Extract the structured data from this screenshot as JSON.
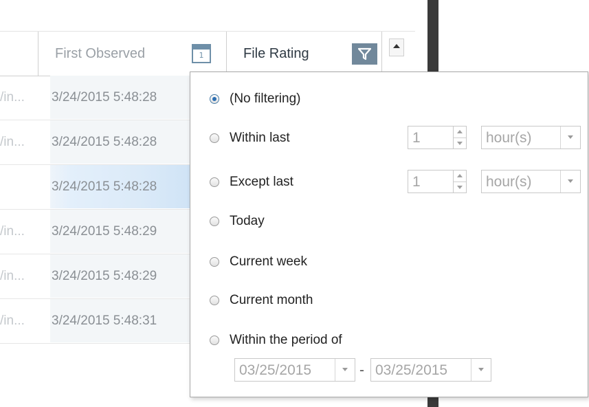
{
  "table": {
    "headers": {
      "first_observed": "First Observed",
      "calendar_icon_text": "1",
      "file_rating": "File Rating"
    },
    "rows": [
      {
        "path": "/in...",
        "first_observed": "3/24/2015 5:48:28",
        "selected": false
      },
      {
        "path": "/in...",
        "first_observed": "3/24/2015 5:48:28",
        "selected": false
      },
      {
        "path": "",
        "first_observed": "3/24/2015 5:48:28",
        "selected": true
      },
      {
        "path": "/in...",
        "first_observed": "3/24/2015 5:48:29",
        "selected": false
      },
      {
        "path": "/in...",
        "first_observed": "3/24/2015 5:48:29",
        "selected": false
      },
      {
        "path": "/in...",
        "first_observed": "3/24/2015 5:48:31",
        "selected": false
      }
    ]
  },
  "filter_panel": {
    "options": {
      "no_filtering": "(No filtering)",
      "within_last": "Within last",
      "except_last": "Except last",
      "today": "Today",
      "current_week": "Current week",
      "current_month": "Current month",
      "within_period": "Within the period of"
    },
    "selected_option": "no_filtering",
    "within_last": {
      "value": "1",
      "unit": "hour(s)"
    },
    "except_last": {
      "value": "1",
      "unit": "hour(s)"
    },
    "period": {
      "from": "03/25/2015",
      "separator": "-",
      "to": "03/25/2015"
    }
  },
  "colors": {
    "filter_button": "#71889b",
    "radio_selected": "#2d6fb2",
    "selected_row": "#dbeaf8"
  }
}
